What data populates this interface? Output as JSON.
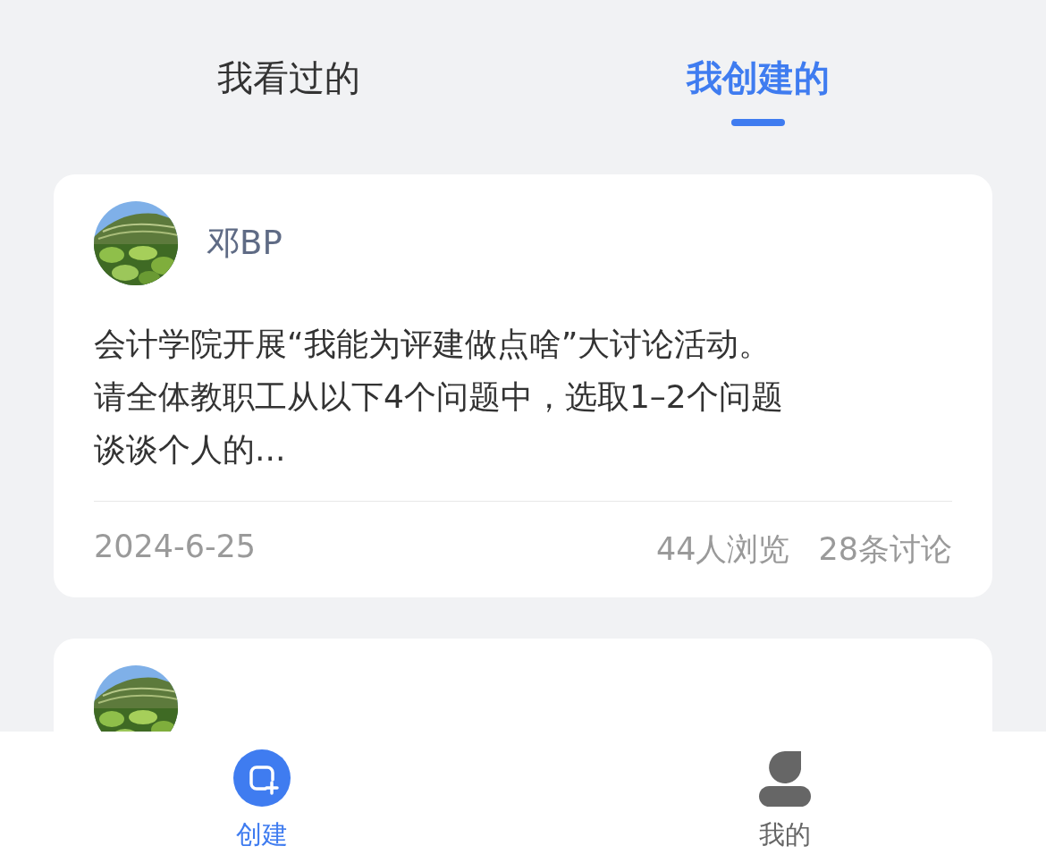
{
  "tabs": [
    {
      "label": "我看过的",
      "selected": false
    },
    {
      "label": "我创建的",
      "selected": true
    }
  ],
  "posts": [
    {
      "avatar": {
        "kind": "picture"
      },
      "author": "邓BP",
      "body_lines": [
        "会计学院开展“我能为评建做点啥”大讨论活动。",
        "请全体教职工从以下4个问题中，选取1–2个问题",
        "谈谈个人的..."
      ],
      "date": "2024-6-25",
      "views": "44人浏览",
      "discussions": "28条讨论"
    },
    {
      "avatar": {
        "kind": "picture"
      }
    }
  ],
  "bottom_nav": [
    {
      "label": "创建",
      "kind": "create",
      "selected": true
    },
    {
      "label": "我的",
      "kind": "profile",
      "selected": false
    }
  ]
}
